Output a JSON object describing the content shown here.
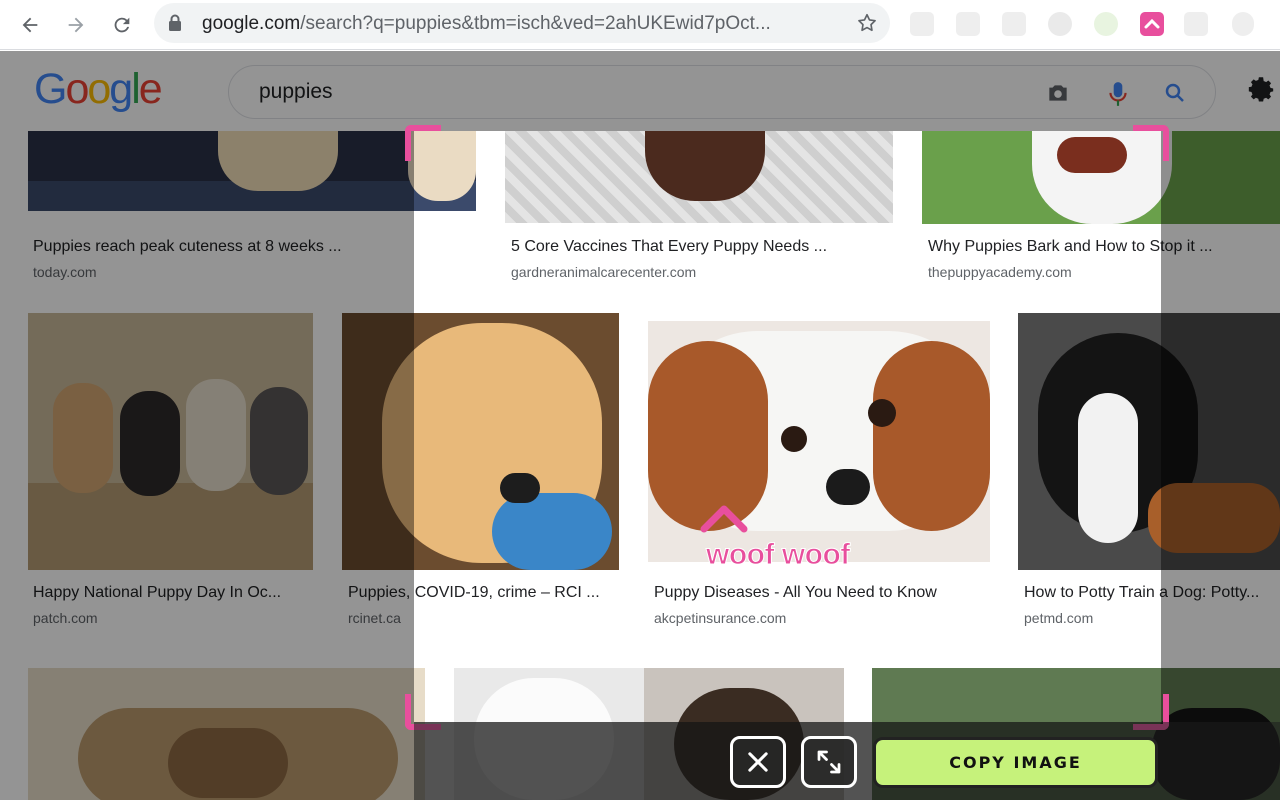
{
  "browser": {
    "url_host": "google.com",
    "url_rest": "/search?q=puppies&tbm=isch&ved=2ahUKEwid7pOct...",
    "extension_icons": [
      "generic-extension-icon",
      "generic-extension-icon",
      "generic-extension-icon",
      "generic-extension-icon",
      "generic-extension-icon",
      "pink-extension-icon",
      "puzzle-extension-icon",
      "profile-avatar"
    ]
  },
  "google": {
    "logo_letters": [
      "G",
      "o",
      "o",
      "g",
      "l",
      "e"
    ],
    "logo_colors": [
      "#4285F4",
      "#EA4335",
      "#FBBC05",
      "#4285F4",
      "#34A853",
      "#EA4335"
    ],
    "query": "puppies"
  },
  "results": [
    {
      "title": "Puppies reach peak cuteness at 8 weeks ...",
      "source": "today.com"
    },
    {
      "title": "5 Core Vaccines That Every Puppy Needs ...",
      "source": "gardneranimalcarecenter.com"
    },
    {
      "title": "Why Puppies Bark and How to Stop it ...",
      "source": "thepuppyacademy.com"
    },
    {
      "title": "Happy National Puppy Day In Oc...",
      "source": "patch.com"
    },
    {
      "title": "Puppies, COVID-19, crime – RCI ...",
      "source": "rcinet.ca"
    },
    {
      "title": "Puppy Diseases - All You Need to Know",
      "source": "akcpetinsurance.com"
    },
    {
      "title": "How to Potty Train a Dog: Potty...",
      "source": "petmd.com"
    }
  ],
  "capture": {
    "annotation": "woof woof",
    "copy_label": "COPY IMAGE",
    "accent_color": "#e84f9d",
    "copy_color": "#c6f27b"
  }
}
